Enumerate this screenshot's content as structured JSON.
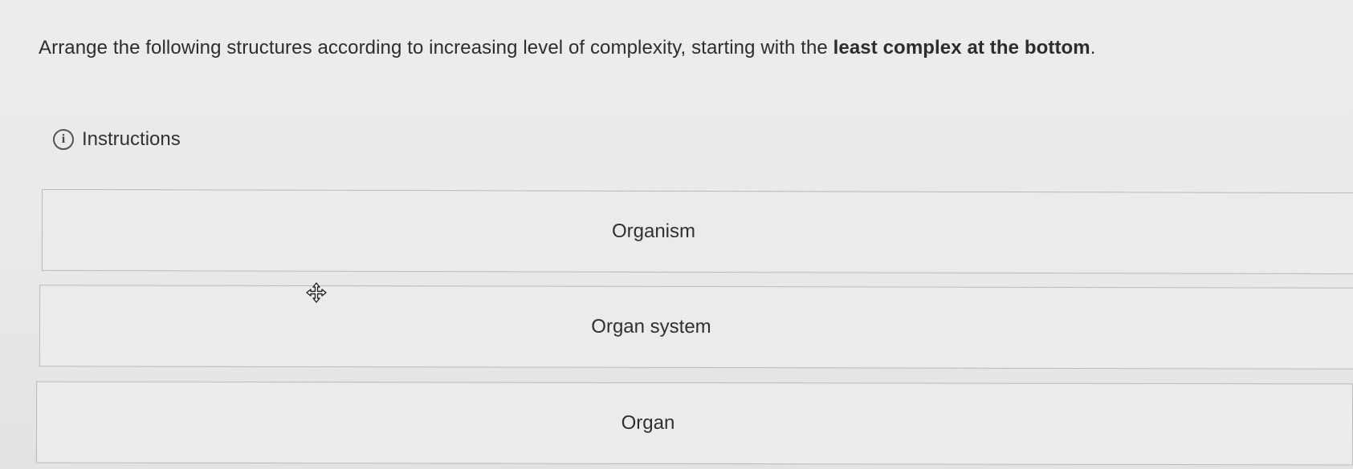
{
  "question": {
    "text_regular": "Arrange the following structures according to increasing level of complexity, starting with the ",
    "text_bold": "least complex at the bottom",
    "text_end": "."
  },
  "instructions": {
    "label": "Instructions",
    "icon": "info-icon",
    "icon_glyph": "i"
  },
  "sortable_items": [
    {
      "label": "Organism"
    },
    {
      "label": "Organ system"
    },
    {
      "label": "Organ"
    }
  ],
  "cursor": {
    "icon": "move-cursor-icon"
  }
}
